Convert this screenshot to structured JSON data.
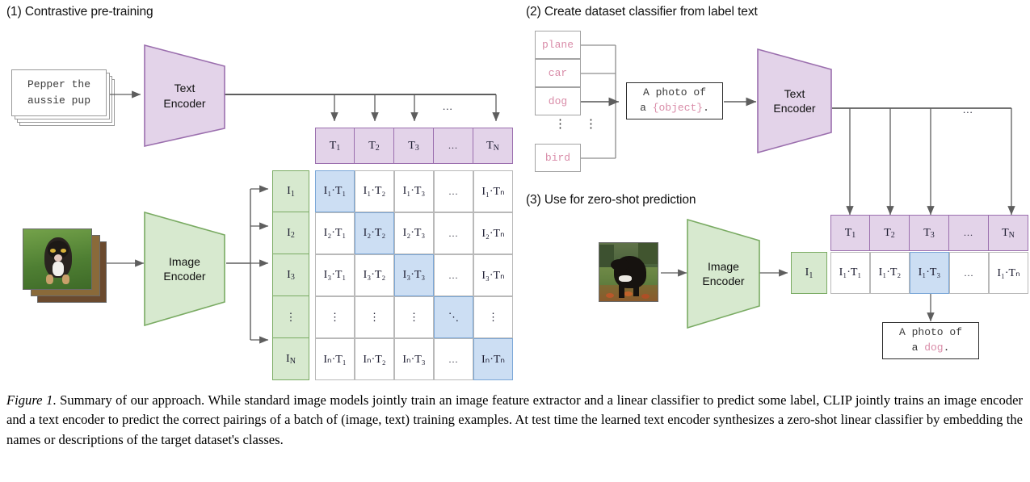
{
  "figure": {
    "caption_lead": "Figure 1",
    "caption_text": ". Summary of our approach. While standard image models jointly train an image feature extractor and a linear classifier to predict some label, CLIP jointly trains an image encoder and a text encoder to predict the correct pairings of a batch of (image, text) training examples. At test time the learned text encoder synthesizes a zero-shot linear classifier by embedding the names or descriptions of the target dataset's classes."
  },
  "colors": {
    "purple_fill": "#e3d3e9",
    "purple_stroke": "#9b6fae",
    "green_fill": "#d7e9cf",
    "green_stroke": "#7aab63",
    "blue_highlight": "#ccdef3",
    "blue_stroke": "#7ba7d7",
    "pink_text": "#d98ca8",
    "line_gray": "#5e5e5e"
  },
  "panel1": {
    "title": "(1) Contrastive pre-training",
    "text_card": "Pepper the\naussie pup",
    "text_encoder_label": [
      "Text",
      "Encoder"
    ],
    "image_encoder_label": [
      "Image",
      "Encoder"
    ],
    "text_vector": [
      "T₁",
      "T₂",
      "T₃",
      "...",
      "Tₙ"
    ],
    "text_vector_items": [
      {
        "base": "T",
        "sub": "1"
      },
      {
        "base": "T",
        "sub": "2"
      },
      {
        "base": "T",
        "sub": "3"
      },
      {
        "base": "...",
        "sub": ""
      },
      {
        "base": "T",
        "sub": "N"
      }
    ],
    "image_vector_items": [
      {
        "base": "I",
        "sub": "1"
      },
      {
        "base": "I",
        "sub": "2"
      },
      {
        "base": "I",
        "sub": "3"
      },
      {
        "base": "⋮",
        "sub": ""
      },
      {
        "base": "I",
        "sub": "N"
      }
    ],
    "matrix_rows": [
      [
        {
          "text": "I₁·T₁",
          "highlight": true
        },
        {
          "text": "I₁·T₂",
          "highlight": false
        },
        {
          "text": "I₁·T₃",
          "highlight": false
        },
        {
          "text": "...",
          "highlight": false
        },
        {
          "text": "I₁·Tₙ",
          "highlight": false
        }
      ],
      [
        {
          "text": "I₂·T₁",
          "highlight": false
        },
        {
          "text": "I₂·T₂",
          "highlight": true
        },
        {
          "text": "I₂·T₃",
          "highlight": false
        },
        {
          "text": "...",
          "highlight": false
        },
        {
          "text": "I₂·Tₙ",
          "highlight": false
        }
      ],
      [
        {
          "text": "I₃·T₁",
          "highlight": false
        },
        {
          "text": "I₃·T₂",
          "highlight": false
        },
        {
          "text": "I₃·T₃",
          "highlight": true
        },
        {
          "text": "...",
          "highlight": false
        },
        {
          "text": "I₃·Tₙ",
          "highlight": false
        }
      ],
      [
        {
          "text": "⋮",
          "highlight": false
        },
        {
          "text": "⋮",
          "highlight": false
        },
        {
          "text": "⋮",
          "highlight": false
        },
        {
          "text": "⋱",
          "highlight": true
        },
        {
          "text": "⋮",
          "highlight": false
        }
      ],
      [
        {
          "text": "Iₙ·T₁",
          "highlight": false
        },
        {
          "text": "Iₙ·T₂",
          "highlight": false
        },
        {
          "text": "Iₙ·T₃",
          "highlight": false
        },
        {
          "text": "...",
          "highlight": false
        },
        {
          "text": "Iₙ·Tₙ",
          "highlight": true
        }
      ]
    ]
  },
  "panel2": {
    "title": "(2) Create dataset classifier from label text",
    "labels": [
      "plane",
      "car",
      "dog",
      "bird"
    ],
    "label_ellipsis": "⋮",
    "prompt_line1": "A photo of",
    "prompt_line2_prefix": "a ",
    "prompt_line2_slot": "{object}",
    "prompt_line2_suffix": ".",
    "text_encoder_label": [
      "Text",
      "Encoder"
    ]
  },
  "panel3": {
    "title": "(3) Use for zero-shot prediction",
    "image_encoder_label": [
      "Image",
      "Encoder"
    ],
    "image_feature": {
      "base": "I",
      "sub": "1"
    },
    "text_vector_items": [
      {
        "base": "T",
        "sub": "1"
      },
      {
        "base": "T",
        "sub": "2"
      },
      {
        "base": "T",
        "sub": "3"
      },
      {
        "base": "...",
        "sub": ""
      },
      {
        "base": "T",
        "sub": "N"
      }
    ],
    "score_row": [
      {
        "text": "I₁·T₁",
        "highlight": false
      },
      {
        "text": "I₁·T₂",
        "highlight": false
      },
      {
        "text": "I₁·T₃",
        "highlight": true
      },
      {
        "text": "...",
        "highlight": false
      },
      {
        "text": "I₁·Tₙ",
        "highlight": false
      }
    ],
    "result_line1": "A photo of",
    "result_line2_prefix": "a ",
    "result_line2_slot": "dog",
    "result_line2_suffix": "."
  }
}
